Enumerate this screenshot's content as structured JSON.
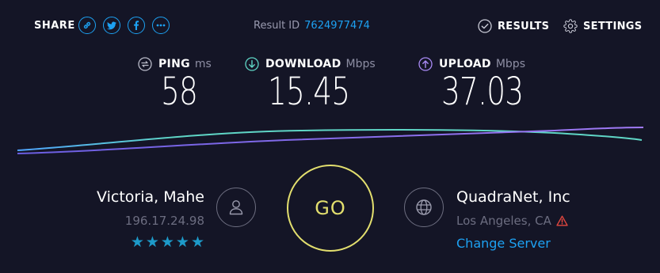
{
  "header": {
    "share_label": "SHARE",
    "share_buttons": [
      "link-icon",
      "twitter-icon",
      "facebook-icon",
      "more-icon"
    ],
    "result_label": "Result ID",
    "result_id": "7624977474",
    "results_label": "RESULTS",
    "settings_label": "SETTINGS"
  },
  "metrics": {
    "ping": {
      "name": "PING",
      "unit": "ms",
      "value": "58",
      "icon": "ping-icon"
    },
    "download": {
      "name": "DOWNLOAD",
      "unit": "Mbps",
      "value": "15.45",
      "icon": "download-arrow-icon"
    },
    "upload": {
      "name": "UPLOAD",
      "unit": "Mbps",
      "value": "37.03",
      "icon": "upload-arrow-icon"
    }
  },
  "isp": {
    "name": "Victoria, Mahe",
    "ip": "196.17.24.98",
    "stars": "★★★★★",
    "rating": 5
  },
  "go_label": "GO",
  "server": {
    "name": "QuadraNet, Inc",
    "location": "Los Angeles, CA",
    "change_label": "Change Server"
  },
  "colors": {
    "background": "#141526",
    "accent_blue": "#1da1f2",
    "download_cyan": "#5fd6c6",
    "upload_purple": "#9b6ef3",
    "go_yellow": "#e3df6e",
    "warning_red": "#e2473f"
  }
}
